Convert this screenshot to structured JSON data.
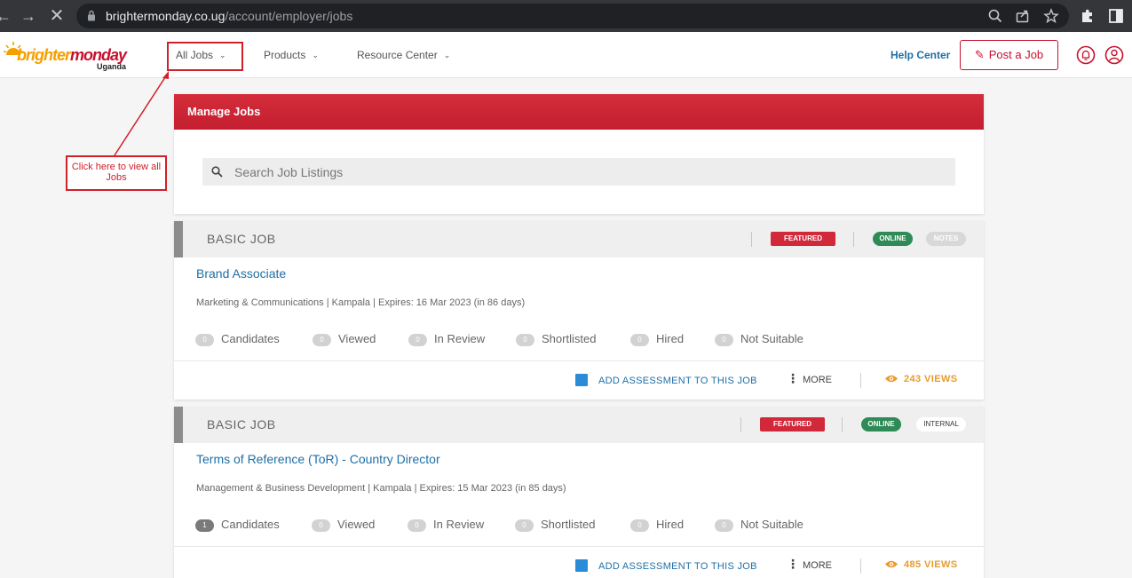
{
  "browser": {
    "back_icon": "back-arrow-icon",
    "forward_icon": "forward-arrow-icon",
    "stop_icon": "close-icon",
    "url_host": "brightermonday.co.ug",
    "url_path": "/account/employer/jobs"
  },
  "site": {
    "logo_part1": "brighter",
    "logo_part2": "monday",
    "logo_country": "Uganda",
    "nav": [
      {
        "label": "All Jobs"
      },
      {
        "label": "Products"
      },
      {
        "label": "Resource Center"
      }
    ],
    "help_label": "Help Center",
    "post_job_label": "Post a Job"
  },
  "annotation": {
    "text": "Click here to view all Jobs"
  },
  "manage": {
    "title": "Manage Jobs",
    "search_placeholder": "Search Job Listings"
  },
  "jobs": [
    {
      "type": "BASIC JOB",
      "badge_featured": "FEATURED",
      "badge_status": "ONLINE",
      "badge_extra": "NOTES",
      "title": "Brand Associate",
      "meta": "Marketing & Communications | Kampala | Expires: 16 Mar 2023 (in 86 days)",
      "stats": [
        {
          "count": "0",
          "label": "Candidates"
        },
        {
          "count": "0",
          "label": "Viewed"
        },
        {
          "count": "0",
          "label": "In Review"
        },
        {
          "count": "0",
          "label": "Shortlisted"
        },
        {
          "count": "0",
          "label": "Hired"
        },
        {
          "count": "0",
          "label": "Not Suitable"
        }
      ],
      "assess_label": "ADD ASSESSMENT TO THIS JOB",
      "more_label": "MORE",
      "views_label": "243 VIEWS"
    },
    {
      "type": "BASIC JOB",
      "badge_featured": "FEATURED",
      "badge_status": "ONLINE",
      "badge_extra": "INTERNAL",
      "title": "Terms of Reference (ToR) - Country Director",
      "meta": "Management & Business Development | Kampala | Expires: 15 Mar 2023 (in 85 days)",
      "stats": [
        {
          "count": "1",
          "label": "Candidates"
        },
        {
          "count": "0",
          "label": "Viewed"
        },
        {
          "count": "0",
          "label": "In Review"
        },
        {
          "count": "0",
          "label": "Shortlisted"
        },
        {
          "count": "0",
          "label": "Hired"
        },
        {
          "count": "0",
          "label": "Not Suitable"
        }
      ],
      "assess_label": "ADD ASSESSMENT TO THIS JOB",
      "more_label": "MORE",
      "views_label": "485 VIEWS"
    }
  ]
}
